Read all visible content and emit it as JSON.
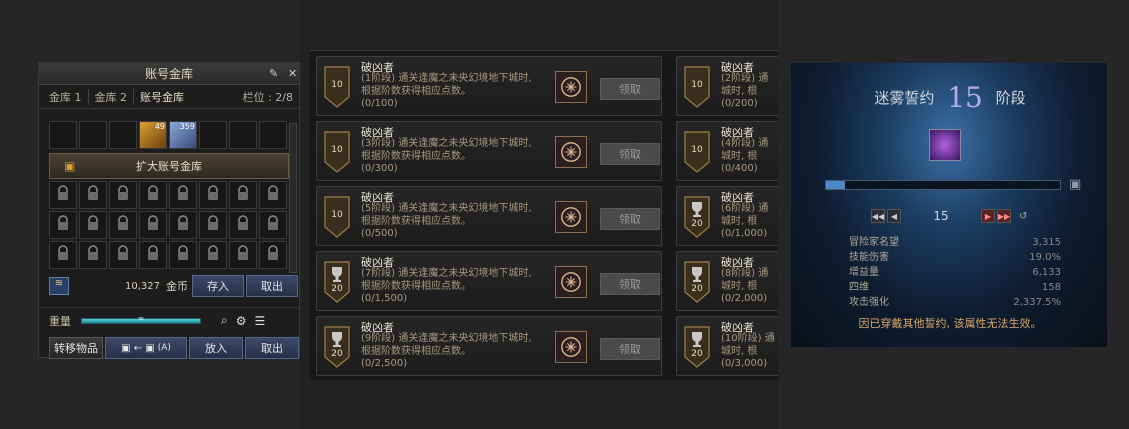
{
  "vault": {
    "title": "账号金库",
    "pin_icon": "pin-icon",
    "close_icon": "close-icon",
    "tabs": [
      {
        "label": "金库 1"
      },
      {
        "label": "金库 2"
      },
      {
        "label": "账号金库"
      }
    ],
    "slots_label": "栏位 : 2/8",
    "items": [
      {
        "count": "49",
        "icon": "treasure-chest-icon"
      },
      {
        "count": "359",
        "icon": "scroll-icon"
      }
    ],
    "expand_label": "扩大账号金库",
    "gold_amount": "10,327",
    "gold_label": "金币",
    "deposit_label": "存入",
    "withdraw_label": "取出",
    "weight_label": "重量",
    "weight_value": "∞",
    "transfer_label": "转移物品",
    "shortcut_label": "(A)",
    "put_in_label": "放入",
    "take_out_label": "取出"
  },
  "achievements": {
    "left": [
      {
        "name": "破凶者",
        "desc": "(1阶段) 通关逢魔之未央幻境地下城时, 根据阶数获得相应点数。",
        "progress": "(0/100)",
        "badge": "10",
        "badge_type": "shield",
        "claim": "领取"
      },
      {
        "name": "破凶者",
        "desc": "(3阶段) 通关逢魔之未央幻境地下城时, 根据阶数获得相应点数。",
        "progress": "(0/300)",
        "badge": "10",
        "badge_type": "shield",
        "claim": "领取"
      },
      {
        "name": "破凶者",
        "desc": "(5阶段) 通关逢魔之未央幻境地下城时, 根据阶数获得相应点数。",
        "progress": "(0/500)",
        "badge": "10",
        "badge_type": "shield",
        "claim": "领取"
      },
      {
        "name": "破凶者",
        "desc": "(7阶段) 通关逢魔之未央幻境地下城时, 根据阶数获得相应点数。",
        "progress": "(0/1,500)",
        "badge": "20",
        "badge_type": "trophy",
        "claim": "领取"
      },
      {
        "name": "破凶者",
        "desc": "(9阶段) 通关逢魔之未央幻境地下城时, 根据阶数获得相应点数。",
        "progress": "(0/2,500)",
        "badge": "20",
        "badge_type": "trophy",
        "claim": "领取"
      }
    ],
    "right": [
      {
        "name": "破凶者",
        "desc": "(2阶段) 通",
        "desc2": "城时, 根",
        "progress": "(0/200)",
        "badge": "10",
        "badge_type": "shield"
      },
      {
        "name": "破凶者",
        "desc": "(4阶段) 通",
        "desc2": "城时, 根",
        "progress": "(0/400)",
        "badge": "10",
        "badge_type": "shield"
      },
      {
        "name": "破凶者",
        "desc": "(6阶段) 通",
        "desc2": "城时, 根",
        "progress": "(0/1,000)",
        "badge": "20",
        "badge_type": "trophy"
      },
      {
        "name": "破凶者",
        "desc": "(8阶段) 通",
        "desc2": "城时, 根",
        "progress": "(0/2,000)",
        "badge": "20",
        "badge_type": "trophy"
      },
      {
        "name": "破凶者",
        "desc": "(10阶段) 通",
        "desc2": "城时, 根",
        "progress": "(0/3,000)",
        "badge": "20",
        "badge_type": "trophy"
      }
    ]
  },
  "pact": {
    "title": "迷雾誓约",
    "stage_number": "15",
    "stage_label": "阶段",
    "progress_fraction": 0.08,
    "level": "15",
    "reset_icon": "reset-icon",
    "stats": [
      {
        "label": "冒险家名望",
        "value": "3,315"
      },
      {
        "label": "技能伤害",
        "value": "19.0%"
      },
      {
        "label": "增益量",
        "value": "6,133"
      },
      {
        "label": "四维",
        "value": "158"
      },
      {
        "label": "攻击强化",
        "value": "2,337.5%"
      }
    ],
    "note": "因已穿戴其他誓约, 该属性无法生效。"
  }
}
